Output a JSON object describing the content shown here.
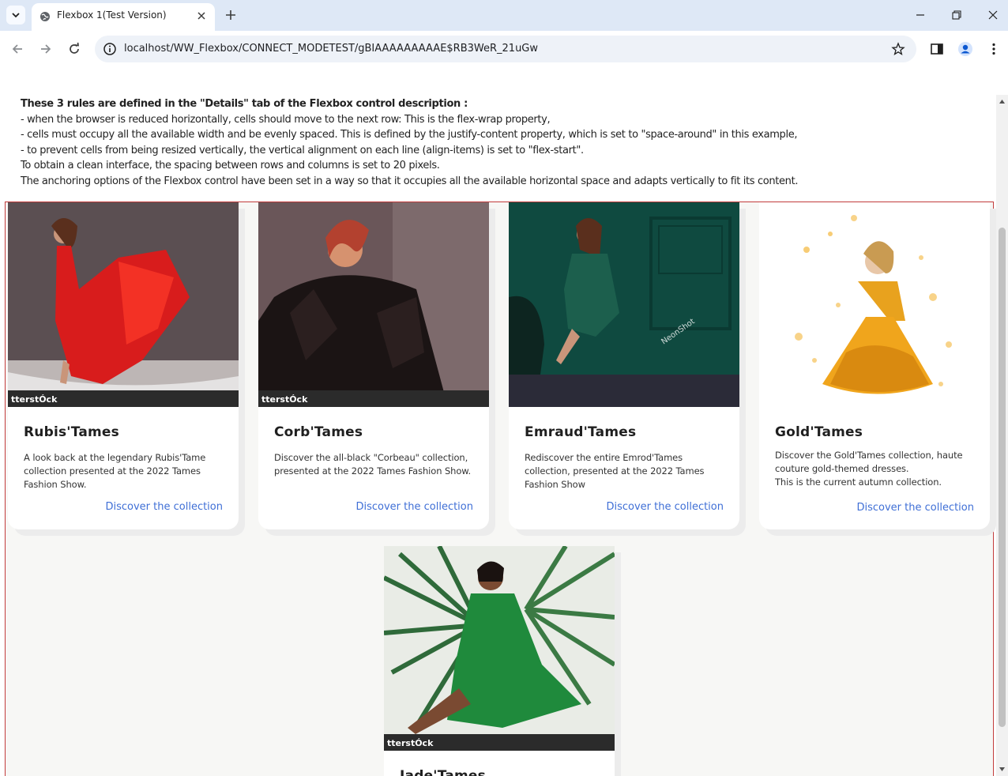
{
  "browser": {
    "tab_title": "Flexbox 1(Test Version)",
    "url": "localhost/WW_Flexbox/CONNECT_MODETEST/gBIAAAAAAAAAE$RB3WeR_21uGw"
  },
  "intro": {
    "heading": "These 3 rules are defined in the \"Details\" tab of the Flexbox control description :",
    "lines": [
      "- when the browser is reduced horizontally, cells should move to the next row: This is the flex-wrap property,",
      "- cells must occupy all the available width and be evenly spaced. This is defined by the justify-content property, which is set to \"space-around\" in this example,",
      "- to prevent cells from being resized vertically, the vertical alignment on each line (align-items) is set to \"flex-start\".",
      "To obtain a clean interface, the spacing between rows and columns is set to 20 pixels.",
      "The anchoring options of the Flexbox control have been set in a way so that it occupies all the available horizontal space and adapts vertically to fit its content."
    ]
  },
  "cards": [
    {
      "title": "Rubis'Tames",
      "description": "A look back at the legendary Rubis'Tame collection presented at the 2022 Tames Fashion Show.",
      "link": "Discover the collection",
      "watermark": "tterstÓck",
      "accent": "#d81c1c"
    },
    {
      "title": "Corb'Tames",
      "description": "Discover the all-black \"Corbeau\" collection, presented at the 2022 Tames Fashion Show.",
      "link": "Discover the collection",
      "watermark": "tterstÓck",
      "accent": "#1b1414"
    },
    {
      "title": "Emraud'Tames",
      "description": "Rediscover the entire Emrod'Tames collection, presented at the 2022 Tames Fashion Show",
      "link": "Discover the collection",
      "watermark": "NeonShot",
      "accent": "#0f4a40"
    },
    {
      "title": "Gold'Tames",
      "description": "Discover the Gold'Tames collection, haute couture gold-themed dresses.",
      "description2": "This is the current autumn collection.",
      "link": "Discover the collection",
      "watermark": "",
      "accent": "#e8a21e"
    },
    {
      "title": "Jade'Tames",
      "description": "",
      "link": "",
      "watermark": "tterstÓck",
      "accent": "#1f8a3c"
    }
  ]
}
